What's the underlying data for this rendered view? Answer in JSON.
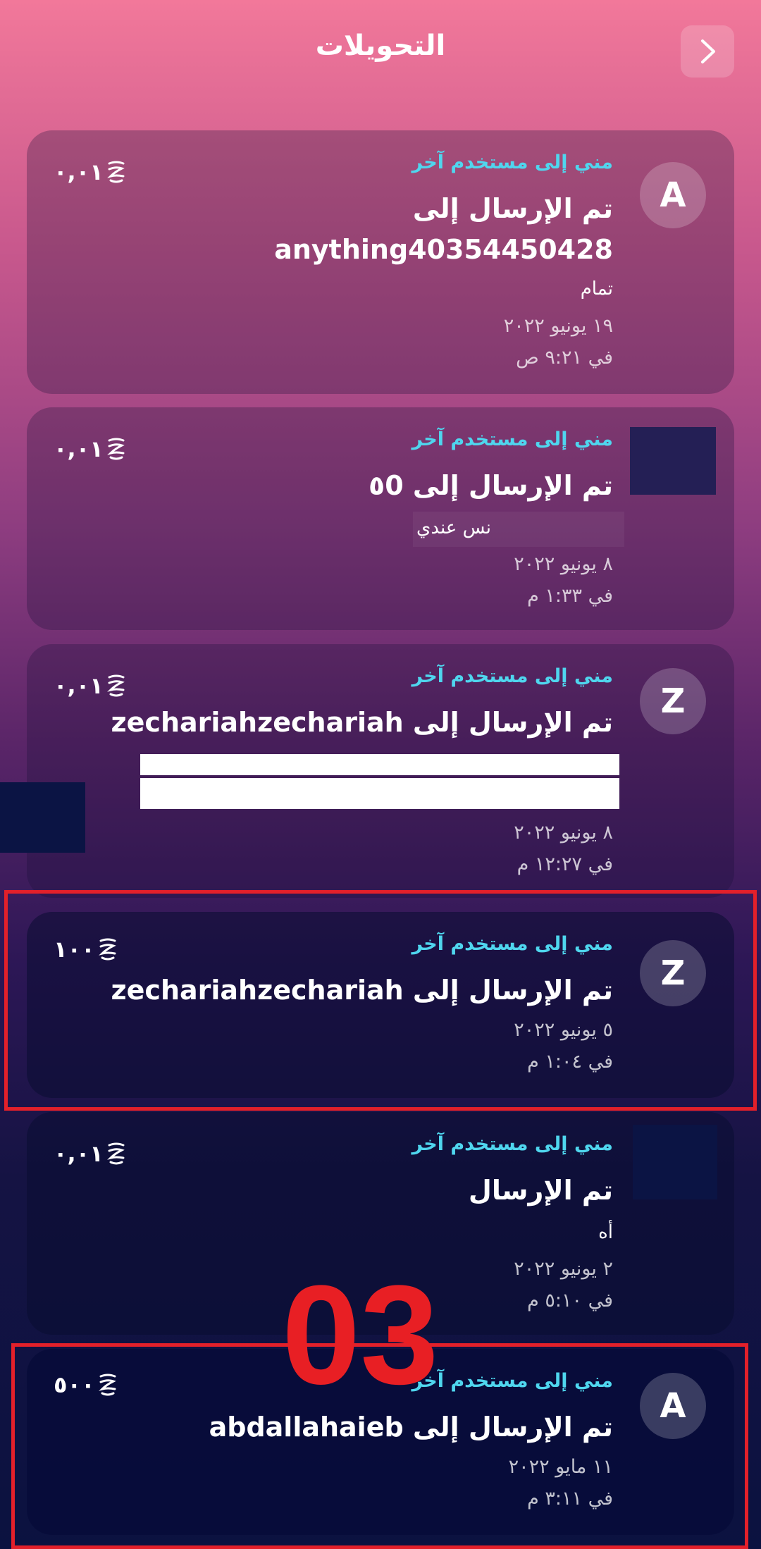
{
  "header": {
    "title": "التحويلات",
    "back_icon": "chevron-right-icon"
  },
  "colors": {
    "direction_label": "#4fd6ee",
    "highlight": "#e3202a"
  },
  "transfers": [
    {
      "avatar": "A",
      "direction": "مني إلى مستخدم آخر",
      "title_line1": "تم الإرسال إلى",
      "title_line2": "anything40354450428",
      "note": "تمام",
      "date": "١٩ يونيو ٢٠٢٢",
      "time": "في ٩:٢١ ص",
      "amount": "٠,٠١"
    },
    {
      "avatar": "",
      "direction": "مني إلى مستخدم آخر",
      "title": "تم الإرسال إلى ٥0",
      "note": "نس عندي",
      "date": "٨ يونيو ٢٠٢٢",
      "time": "في ١:٣٣ م",
      "amount": "٠,٠١"
    },
    {
      "avatar": "Z",
      "direction": "مني إلى مستخدم آخر",
      "title": "تم الإرسال إلى zechariahzechariah",
      "date": "٨ يونيو ٢٠٢٢",
      "time": "في ١٢:٢٧ م",
      "amount": "٠,٠١"
    },
    {
      "avatar": "Z",
      "direction": "مني إلى مستخدم آخر",
      "title": "تم الإرسال إلى zechariahzechariah",
      "date": "٥ يونيو ٢٠٢٢",
      "time": "في ١:٠٤ م",
      "amount": "١٠٠"
    },
    {
      "avatar": "",
      "direction": "مني إلى مستخدم آخر",
      "title": "تم الإرسال",
      "note": "أه",
      "date": "٢ يونيو ٢٠٢٢",
      "time": "في ٥:١٠ م",
      "amount": "٠,٠١"
    },
    {
      "avatar": "A",
      "direction": "مني إلى مستخدم آخر",
      "title": "تم الإرسال إلى abdallahaieb",
      "date": "١١ مايو ٢٠٢٢",
      "time": "في ٣:١١ م",
      "amount": "٥٠٠"
    }
  ],
  "annotation": {
    "step_number": "03"
  }
}
